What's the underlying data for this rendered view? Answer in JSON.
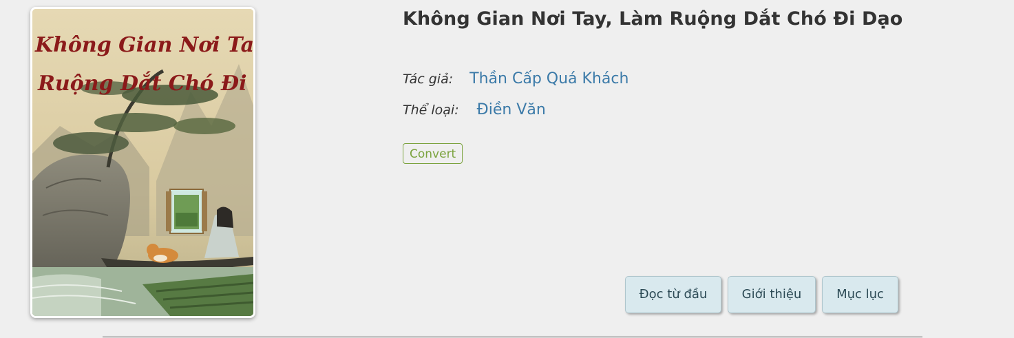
{
  "book": {
    "title": "Không Gian Nơi Tay, Làm Ruộng Dắt Chó Đi Dạo",
    "author_label": "Tác giả:",
    "author": "Thần Cấp Quá Khách",
    "genre_label": "Thể loại:",
    "genre": "Điền Văn",
    "badge": "Convert",
    "cover_text_line1": "Không Gian Nơi Tay Làm",
    "cover_text_line2": "Ruộng Dắt Chó Đi Dạo"
  },
  "actions": {
    "read_from_start": "Đọc từ đầu",
    "introduction": "Giới thiệu",
    "table_of_contents": "Mục lục"
  },
  "colors": {
    "link": "#3b7aa8",
    "badge": "#7ba33e",
    "button_bg": "#d9e9ee",
    "page_bg": "#efefef"
  }
}
